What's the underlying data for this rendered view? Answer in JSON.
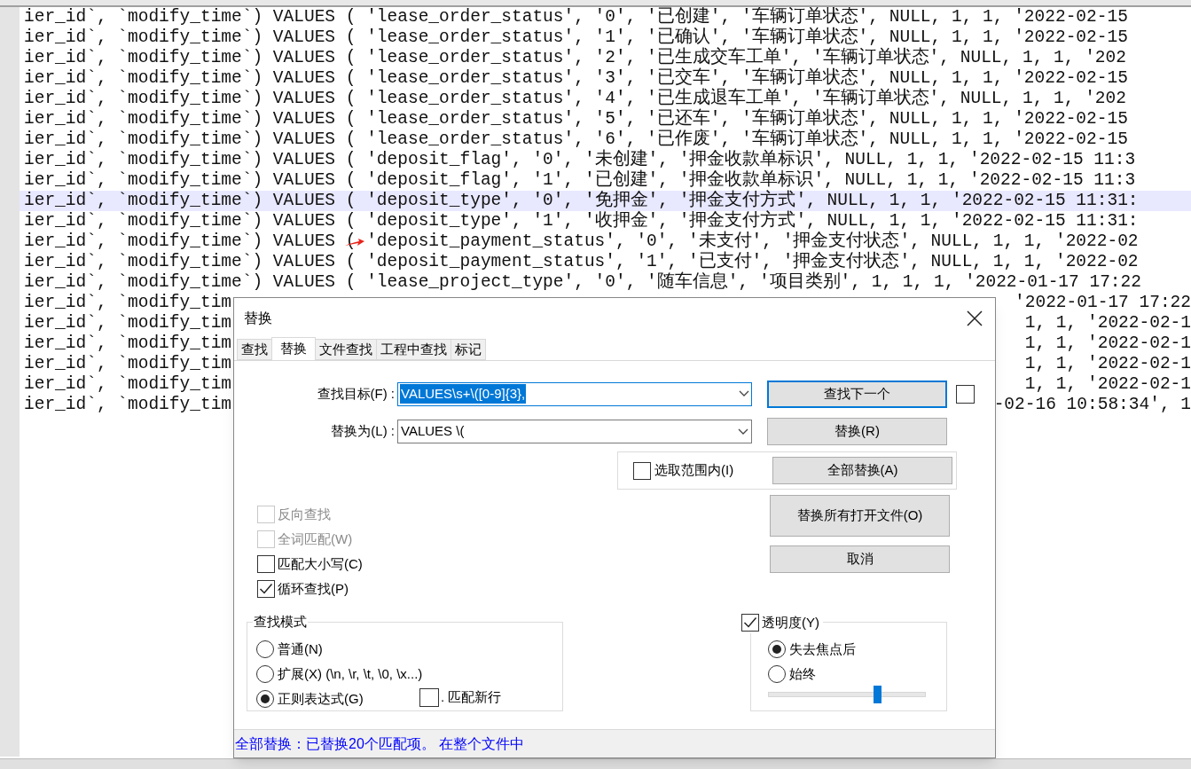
{
  "editor": {
    "lines": [
      {
        "text": "ier_id`, `modify_time`) VALUES ( 'lease_order_status', '0', '已创建', '车辆订单状态', NULL, 1, 1, '2022-02-15",
        "highlighted": false
      },
      {
        "text": "ier_id`, `modify_time`) VALUES ( 'lease_order_status', '1', '已确认', '车辆订单状态', NULL, 1, 1, '2022-02-15",
        "highlighted": false
      },
      {
        "text": "ier_id`, `modify_time`) VALUES ( 'lease_order_status', '2', '已生成交车工单', '车辆订单状态', NULL, 1, 1, '202",
        "highlighted": false
      },
      {
        "text": "ier_id`, `modify_time`) VALUES ( 'lease_order_status', '3', '已交车', '车辆订单状态', NULL, 1, 1, '2022-02-15",
        "highlighted": false
      },
      {
        "text": "ier_id`, `modify_time`) VALUES ( 'lease_order_status', '4', '已生成退车工单', '车辆订单状态', NULL, 1, 1, '202",
        "highlighted": false
      },
      {
        "text": "ier_id`, `modify_time`) VALUES ( 'lease_order_status', '5', '已还车', '车辆订单状态', NULL, 1, 1, '2022-02-15",
        "highlighted": false
      },
      {
        "text": "ier_id`, `modify_time`) VALUES ( 'lease_order_status', '6', '已作废', '车辆订单状态', NULL, 1, 1, '2022-02-15",
        "highlighted": false
      },
      {
        "text": "ier_id`, `modify_time`) VALUES ( 'deposit_flag', '0', '未创建', '押金收款单标识', NULL, 1, 1, '2022-02-15 11:3",
        "highlighted": false
      },
      {
        "text": "ier_id`, `modify_time`) VALUES ( 'deposit_flag', '1', '已创建', '押金收款单标识', NULL, 1, 1, '2022-02-15 11:3",
        "highlighted": false
      },
      {
        "text": "ier_id`, `modify_time`) VALUES ( 'deposit_type', '0', '免押金', '押金支付方式', NULL, 1, 1, '2022-02-15 11:31:",
        "highlighted": true
      },
      {
        "text": "ier_id`, `modify_time`) VALUES ( 'deposit_type', '1', '收押金', '押金支付方式', NULL, 1, 1, '2022-02-15 11:31:",
        "highlighted": false
      },
      {
        "text": "ier_id`, `modify_time`) VALUES ( 'deposit_payment_status', '0', '未支付', '押金支付状态', NULL, 1, 1, '2022-02",
        "highlighted": false,
        "annotated": true
      },
      {
        "text": "ier_id`, `modify_time`) VALUES ( 'deposit_payment_status', '1', '已支付', '押金支付状态', NULL, 1, 1, '2022-02",
        "highlighted": false
      },
      {
        "text": "ier_id`, `modify_time`) VALUES ( 'lease_project_type', '0', '随车信息', '项目类别', 1, 1, 1, '2022-01-17 17:22",
        "highlighted": false
      },
      {
        "left": "ier_id`, `modify_tim",
        "right": "'2022-01-17 17:22",
        "highlighted": false
      },
      {
        "left": "ier_id`, `modify_tim",
        "right": "1, 1, '2022-02-1",
        "highlighted": false
      },
      {
        "left": "ier_id`, `modify_tim",
        "right": "1, 1, '2022-02-1",
        "highlighted": false
      },
      {
        "left": "ier_id`, `modify_tim",
        "right": "1, 1, '2022-02-1",
        "highlighted": false
      },
      {
        "left": "ier_id`, `modify_tim",
        "right": "1, 1, '2022-02-1",
        "highlighted": false
      },
      {
        "left": "ier_id`, `modify_tim",
        "right": "-02-16 10:58:34', 1",
        "highlighted": false
      }
    ]
  },
  "dialog": {
    "title": "替换",
    "tabs": [
      {
        "label": "查找",
        "selected": false
      },
      {
        "label": "替换",
        "selected": true
      },
      {
        "label": "文件查找",
        "selected": false
      },
      {
        "label": "工程中查找",
        "selected": false
      },
      {
        "label": "标记",
        "selected": false
      }
    ],
    "find": {
      "label": "查找目标(F) :",
      "value": "VALUES\\s+\\([0-9]{3},",
      "text_selected": true
    },
    "replace": {
      "label": "替换为(L) :",
      "value": "VALUES \\("
    },
    "find_next": {
      "label": "查找下一个",
      "focused": true
    },
    "extra_checkbox": {
      "checked": false
    },
    "replace_button": {
      "label": "替换(R)"
    },
    "in_selection": {
      "label": "选取范围内(I)",
      "checked": false
    },
    "replace_all": {
      "label": "全部替换(A)"
    },
    "replace_all_open": {
      "label": "替换所有打开文件(O)"
    },
    "cancel": {
      "label": "取消"
    },
    "options": [
      {
        "label": "反向查找",
        "checked": false,
        "disabled": true
      },
      {
        "label": "全词匹配(W)",
        "checked": false,
        "disabled": true
      },
      {
        "label": "匹配大小写(C)",
        "checked": false,
        "disabled": false
      },
      {
        "label": "循环查找(P)",
        "checked": true,
        "disabled": false
      }
    ],
    "search_mode": {
      "title": "查找模式",
      "modes": [
        {
          "label": "普通(N)",
          "selected": false
        },
        {
          "label": "扩展(X) (\\n, \\r, \\t, \\0, \\x...)",
          "selected": false
        },
        {
          "label": "正则表达式(G)",
          "selected": true
        }
      ],
      "dot_newline": {
        "label": ". 匹配新行",
        "checked": false
      }
    },
    "transparency": {
      "label": "透明度(Y)",
      "checked": true,
      "modes": [
        {
          "label": "失去焦点后",
          "selected": true
        },
        {
          "label": "始终",
          "selected": false
        }
      ],
      "level": 0.7
    },
    "status": "全部替换：已替换20个匹配项。 在整个文件中"
  }
}
